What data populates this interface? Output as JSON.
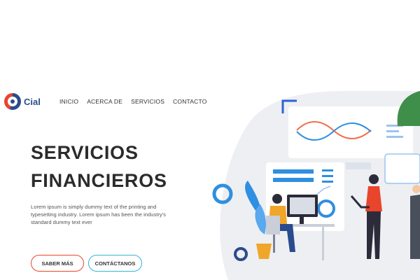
{
  "brand": {
    "name": "Cial"
  },
  "nav": {
    "items": [
      {
        "label": "INICIO"
      },
      {
        "label": "ACERCA DE"
      },
      {
        "label": "SERVICIOS"
      },
      {
        "label": "CONTACTO"
      }
    ]
  },
  "hero": {
    "title_line1": "SERVICIOS",
    "title_line2": "FINANCIEROS",
    "description": "Lorem ipsum is simply dummy text of the printing and typesetting industry. Lorem ipsum has been the industry's standard dummy text ever",
    "primary_button": "SABER MÁS",
    "secondary_button": "CONTÁCTANOS"
  },
  "colors": {
    "brand_blue": "#2a4b8d",
    "accent_red": "#e8452c",
    "accent_cyan": "#34b3d6",
    "illustration_blue": "#2f8fe0",
    "illustration_bg": "#eeeff3"
  },
  "illustration": {
    "icon": "financial-team-illustration"
  }
}
